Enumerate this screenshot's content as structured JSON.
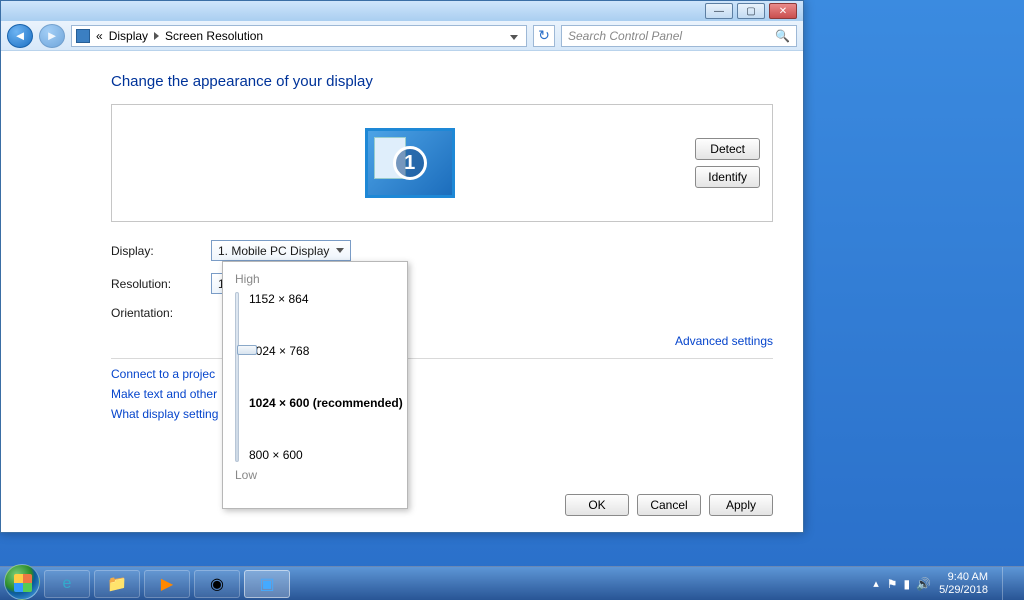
{
  "window": {
    "breadcrumb_prefix": "«",
    "breadcrumb_1": "Display",
    "breadcrumb_2": "Screen Resolution",
    "search_placeholder": "Search Control Panel"
  },
  "page": {
    "heading": "Change the appearance of your display",
    "monitor_number": "1",
    "detect": "Detect",
    "identify": "Identify",
    "display_label": "Display:",
    "display_value": "1. Mobile PC Display",
    "resolution_label": "Resolution:",
    "resolution_value": "1024 × 768",
    "orientation_label": "Orientation:",
    "advanced": "Advanced settings",
    "link_projector": "Connect to a projec",
    "link_text_size": "Make text and other",
    "link_what": "What display setting",
    "ok": "OK",
    "cancel": "Cancel",
    "apply": "Apply"
  },
  "slider": {
    "high": "High",
    "low": "Low",
    "opts": [
      "1152 × 864",
      "1024 × 768",
      "1024 × 600 (recommended)",
      "800 × 600"
    ],
    "thumb_index": 1
  },
  "taskbar": {
    "time": "9:40 AM",
    "date": "5/29/2018"
  }
}
